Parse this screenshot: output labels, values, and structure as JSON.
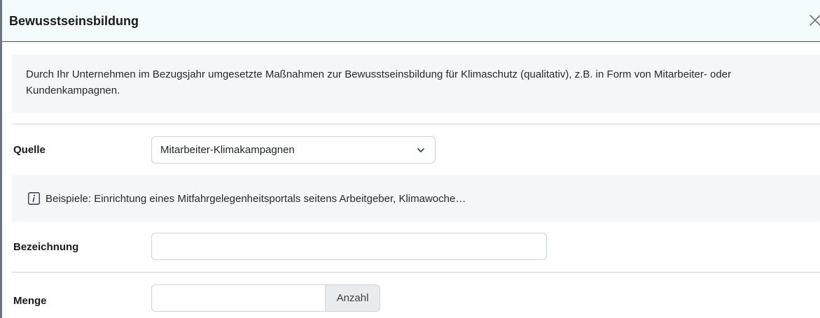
{
  "modal": {
    "title": "Bewusstseinsbildung",
    "close_icon": "close-icon",
    "description": "Durch Ihr Unternehmen im Bezugsjahr umgesetzte Maßnahmen zur Bewusstseinsbildung für Klimaschutz (qualitativ), z.B. in Form von Mitarbeiter- oder Kundenkampagnen."
  },
  "form": {
    "quelle": {
      "label": "Quelle",
      "selected": "Mitarbeiter-Klimakampagnen",
      "chevron_icon": "chevron-down-icon"
    },
    "hint": {
      "icon": "info-icon",
      "text": "Beispiele: Einrichtung eines Mitfahrgelegenheitsportals seitens Arbeitgeber, Klimawoche…"
    },
    "bezeichnung": {
      "label": "Bezeichnung",
      "value": ""
    },
    "menge": {
      "label": "Menge",
      "value": "",
      "unit": "Anzahl"
    }
  },
  "colors": {
    "header_background": "#f3fbfe",
    "panel_background": "#f5f6f8",
    "addon_background": "#e9ecef",
    "border": "#ced4da"
  }
}
